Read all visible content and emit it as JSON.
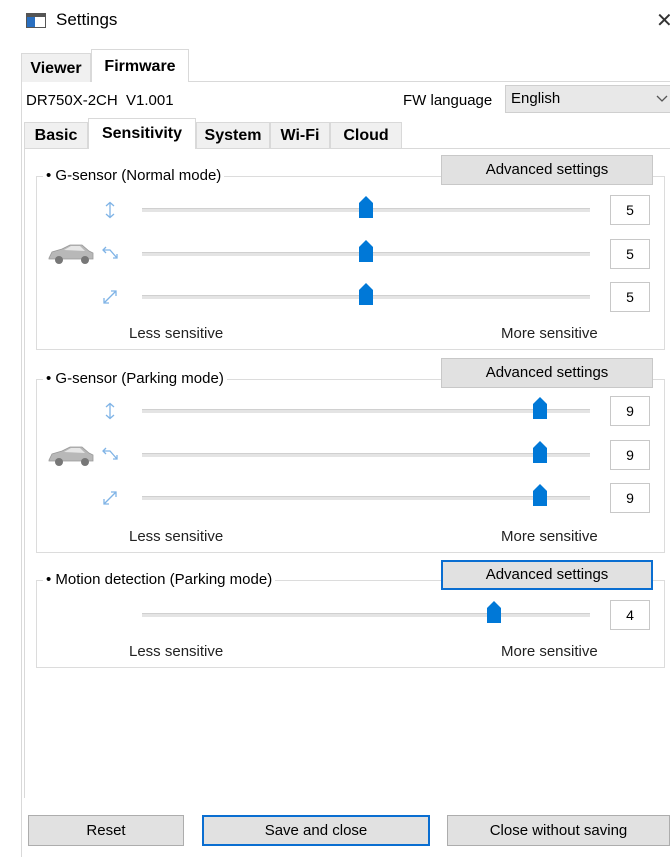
{
  "window": {
    "title": "Settings",
    "icon": "settings-window-icon",
    "close_glyph": "✕"
  },
  "outer_tabs": [
    {
      "label": "Viewer",
      "active": false
    },
    {
      "label": "Firmware",
      "active": true
    }
  ],
  "device": {
    "model": "DR750X-2CH",
    "version": "V1.001"
  },
  "fw_language": {
    "label": "FW language",
    "value": "English"
  },
  "inner_tabs": [
    {
      "label": "Basic",
      "active": false
    },
    {
      "label": "Sensitivity",
      "active": true
    },
    {
      "label": "System",
      "active": false
    },
    {
      "label": "Wi-Fi",
      "active": false
    },
    {
      "label": "Cloud",
      "active": false
    }
  ],
  "groups": [
    {
      "title": "• G-sensor (Normal mode)",
      "advanced_label": "Advanced settings",
      "sliders": [
        {
          "axis": "vertical-axis-icon",
          "value": "5",
          "fraction": 0.5
        },
        {
          "axis": "horizontal-axis-icon",
          "value": "5",
          "fraction": 0.5
        },
        {
          "axis": "diagonal-axis-icon",
          "value": "5",
          "fraction": 0.5
        }
      ],
      "less_label": "Less sensitive",
      "more_label": "More sensitive"
    },
    {
      "title": "• G-sensor (Parking mode)",
      "advanced_label": "Advanced settings",
      "sliders": [
        {
          "axis": "vertical-axis-icon",
          "value": "9",
          "fraction": 0.889
        },
        {
          "axis": "horizontal-axis-icon",
          "value": "9",
          "fraction": 0.889
        },
        {
          "axis": "diagonal-axis-icon",
          "value": "9",
          "fraction": 0.889
        }
      ],
      "less_label": "Less sensitive",
      "more_label": "More sensitive"
    },
    {
      "title": "• Motion detection (Parking mode)",
      "advanced_label": "Advanced settings",
      "sliders": [
        {
          "value": "4",
          "fraction": 0.786
        }
      ],
      "less_label": "Less sensitive",
      "more_label": "More sensitive"
    }
  ],
  "buttons": {
    "reset": "Reset",
    "save_close": "Save and close",
    "close_no_save": "Close without saving"
  },
  "colors": {
    "accent": "#0a6ed1",
    "thumb": "#0078d7",
    "icon": "#7fb3e6"
  }
}
